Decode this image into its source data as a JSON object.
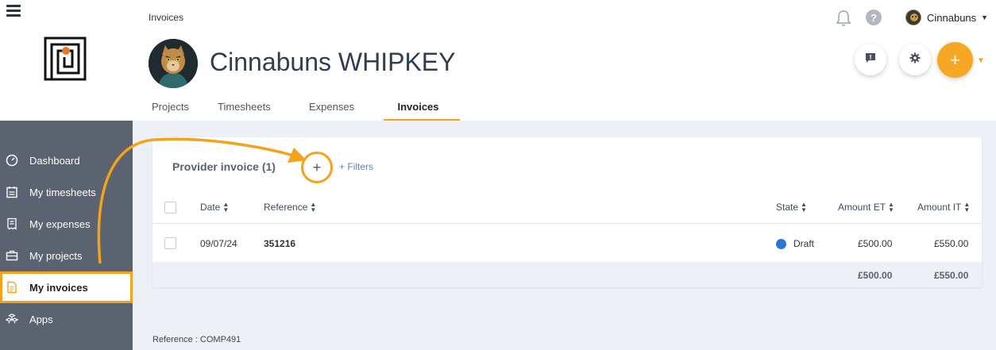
{
  "app": {
    "accent_color": "#f5a21b",
    "sidebar_color": "#5b6270"
  },
  "sidebar": {
    "items": [
      {
        "label": "Dashboard",
        "icon": "dashboard-icon"
      },
      {
        "label": "My timesheets",
        "icon": "timesheet-icon"
      },
      {
        "label": "My expenses",
        "icon": "receipt-icon"
      },
      {
        "label": "My projects",
        "icon": "briefcase-icon"
      },
      {
        "label": "My invoices",
        "icon": "invoice-icon",
        "active": true
      },
      {
        "label": "Apps",
        "icon": "apps-icon"
      }
    ]
  },
  "header": {
    "breadcrumb": "Invoices",
    "user_name": "Cinnabuns",
    "page_title": "Cinnabuns WHIPKEY",
    "help_label": "?",
    "add_label": "+",
    "tabs": [
      {
        "label": "Projects"
      },
      {
        "label": "Timesheets"
      },
      {
        "label": "Expenses"
      },
      {
        "label": "Invoices",
        "active": true
      }
    ]
  },
  "invoices": {
    "title": "Provider invoice (1)",
    "add_label": "+",
    "filters_label": "+ Filters",
    "columns": {
      "date": "Date",
      "reference": "Reference",
      "state": "State",
      "amount_et": "Amount ET",
      "amount_it": "Amount IT"
    },
    "rows": [
      {
        "date": "09/07/24",
        "reference": "351216",
        "state": "Draft",
        "state_color": "#2a78d4",
        "amount_et": "£500.00",
        "amount_it": "£550.00"
      }
    ],
    "totals": {
      "amount_et": "£500.00",
      "amount_it": "£550.00"
    }
  },
  "footer": {
    "reference": "Reference : COMP491"
  }
}
